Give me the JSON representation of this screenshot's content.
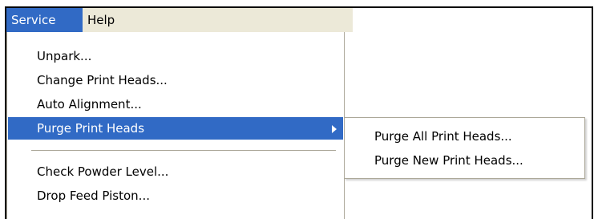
{
  "menubar": {
    "items": [
      {
        "label": "Service"
      },
      {
        "label": "Help"
      }
    ]
  },
  "service_menu": {
    "items": [
      {
        "label": "Unpark..."
      },
      {
        "label": "Change Print Heads..."
      },
      {
        "label": "Auto Alignment..."
      },
      {
        "label": "Purge Print Heads"
      },
      {
        "label": "Check Powder Level..."
      },
      {
        "label": "Drop Feed Piston..."
      }
    ]
  },
  "purge_submenu": {
    "items": [
      {
        "label": "Purge All Print Heads..."
      },
      {
        "label": "Purge New Print Heads..."
      }
    ]
  },
  "colors": {
    "highlight": "#316ac5",
    "menubar_bg": "#ece9d8",
    "border": "#aca899"
  },
  "icons": {
    "submenu_arrow": "chevron-right-icon"
  }
}
